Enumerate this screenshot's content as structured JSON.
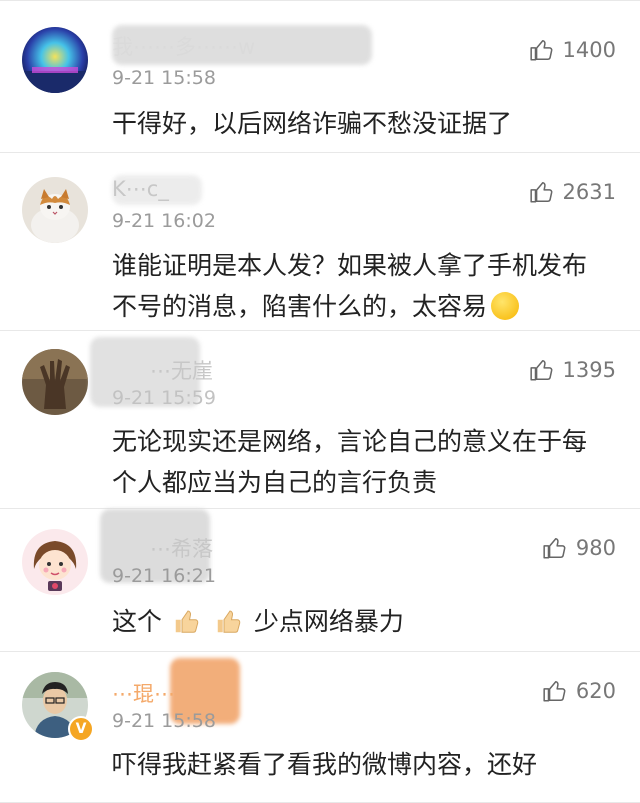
{
  "comments": [
    {
      "name": "我⋯⋯多⋯⋯w",
      "time": "9-21 15:58",
      "likes": "1400",
      "text": [
        "干得好，以后网络诈骗不愁没证据了"
      ]
    },
    {
      "name": "K⋯c_",
      "time": "9-21 16:02",
      "likes": "2631",
      "text": [
        "谁能证明是本人发？如果被人拿了手机发布",
        "不号的消息，陷害什么的，太容易"
      ],
      "emoji": "thinking-face-emoji"
    },
    {
      "name": "⋯无崖",
      "time": "9-21 15:59",
      "likes": "1395",
      "text": [
        "无论现实还是网络，言论自己的意义在于每",
        "个人都应当为自己的言行负责"
      ]
    },
    {
      "name": "⋯希落",
      "time": "9-21 16:21",
      "likes": "980",
      "text_before": "这个",
      "text_after": "少点网络暴力",
      "emoji": "thumbs-up-emoji"
    },
    {
      "name": "⋯琨⋯",
      "time": "9-21 15:58",
      "likes": "620",
      "text": [
        "吓得我赶紧看了看我的微博内容，还好"
      ],
      "badge": "V"
    }
  ],
  "colors": {
    "text": "#222222",
    "name": "#c7c7c7",
    "time": "#9b9b9b",
    "like": "#777777",
    "divider": "#e8e8e8",
    "verified_badge": "#f5a623"
  },
  "icons": {
    "like": "thumbs-up-outline-icon",
    "verified": "verified-badge-icon"
  }
}
